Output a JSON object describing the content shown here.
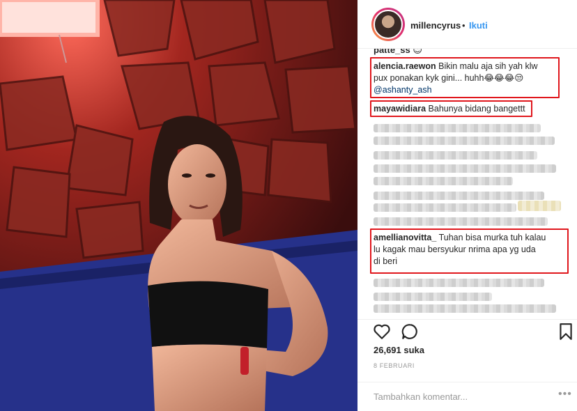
{
  "post": {
    "username": "millencyrus",
    "separator": "•",
    "follow_label": "Ikuti"
  },
  "comments": {
    "partial_top": "patte_ss 😊",
    "items": [
      {
        "author": "alencia.raewon",
        "line1": "Bikin malu aja sih yah klw",
        "line2": "pux ponakan kyk gini... huhh😂😂😂😒",
        "mention": "@ashanty_ash"
      },
      {
        "author": "mayawidiara",
        "text": "Bahunya bidang bangettt"
      },
      {
        "author": "amellianovitta_",
        "line1": "Tuhan bisa murka tuh kalau",
        "line2": "lu kagak mau bersyukur nrima apa yg uda",
        "line3": "di beri"
      }
    ]
  },
  "actions": {
    "like_icon": "heart-icon",
    "comment_icon": "comment-icon",
    "save_icon": "bookmark-icon",
    "likes": "26,691 suka",
    "date": "8 FEBRUARI"
  },
  "composer": {
    "placeholder": "Tambahkan komentar...",
    "more": "•••"
  },
  "colors": {
    "highlight": "#e0161c",
    "link": "#3897f0",
    "text": "#262626",
    "muted": "#999999"
  }
}
